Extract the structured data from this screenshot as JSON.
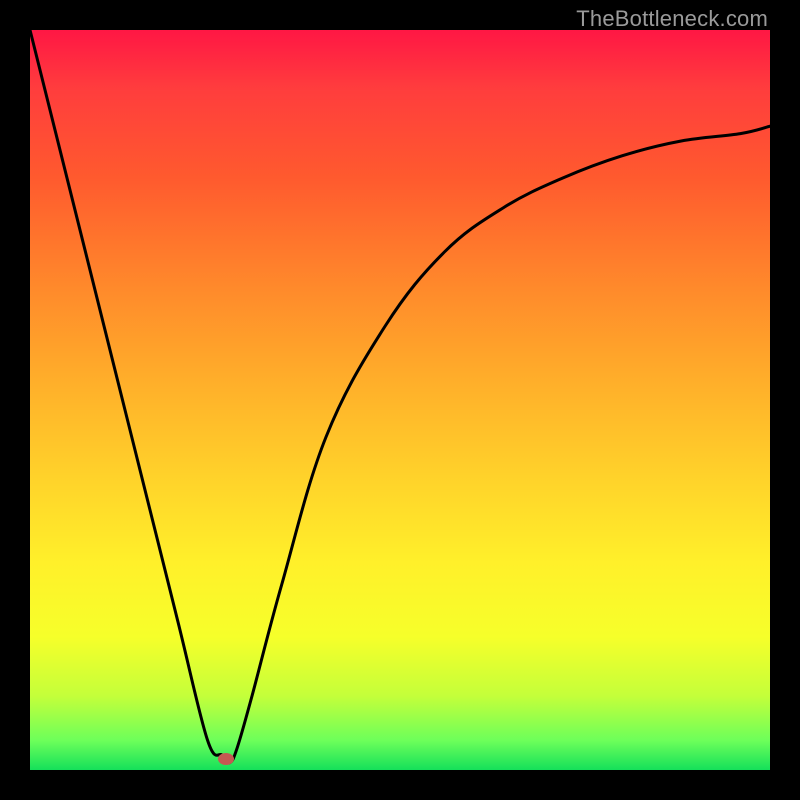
{
  "watermark": "TheBottleneck.com",
  "chart_data": {
    "type": "line",
    "title": "",
    "xlabel": "",
    "ylabel": "",
    "xlim": [
      0,
      100
    ],
    "ylim": [
      0,
      100
    ],
    "grid": false,
    "legend": false,
    "series": [
      {
        "name": "bottleneck-curve",
        "x": [
          0,
          5,
          10,
          15,
          20,
          24,
          26,
          27,
          28,
          30,
          34,
          40,
          48,
          56,
          64,
          72,
          80,
          88,
          96,
          100
        ],
        "values": [
          100,
          80,
          60,
          40,
          20,
          4,
          2,
          1,
          3,
          10,
          25,
          45,
          60,
          70,
          76,
          80,
          83,
          85,
          86,
          87
        ]
      }
    ],
    "marker": {
      "x": 26.5,
      "y": 1.5,
      "color": "#c55a52"
    },
    "background_gradient": {
      "top": "#ff1744",
      "bottom": "#14e05a"
    }
  }
}
